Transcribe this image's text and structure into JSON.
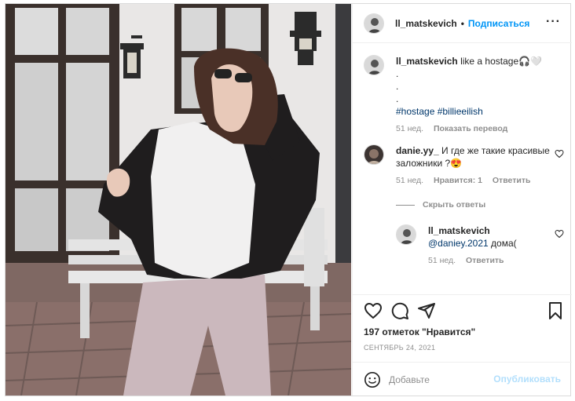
{
  "post": {
    "username": "ll_matskevich",
    "follow_label": "Подписаться",
    "more_icon": "more-horizontal-icon",
    "caption": {
      "text": "like a hostage🎧🤍",
      "dots": ".",
      "hashtags": "#hostage #billieeilish",
      "time": "51 нед.",
      "translate_label": "Показать перевод"
    },
    "comment": {
      "username": "danie.yy_",
      "text": "И где же такие красивые заложники ?😍",
      "time": "51 нед.",
      "likes": "Нравится: 1",
      "reply_label": "Ответить"
    },
    "hide_replies_label": "Скрыть ответы",
    "reply": {
      "username": "ll_matskevich",
      "mention": "@daniey.2021",
      "text": "дома(",
      "time": "51 нед.",
      "reply_label": "Ответить"
    },
    "likes_count": "197 отметок \"Нравится\"",
    "date": "СЕНТЯБРЬ 24, 2021",
    "comment_placeholder": "Добавьте",
    "publish_label": "Опубликовать"
  },
  "icons": {
    "like": "heart-icon",
    "comment": "comment-icon",
    "share": "share-icon",
    "save": "bookmark-icon",
    "emoji": "emoji-icon"
  },
  "colors": {
    "accent": "#0095f6",
    "publish_disabled": "#b2dffc",
    "link": "#00376b",
    "muted": "#8e8e8e"
  }
}
